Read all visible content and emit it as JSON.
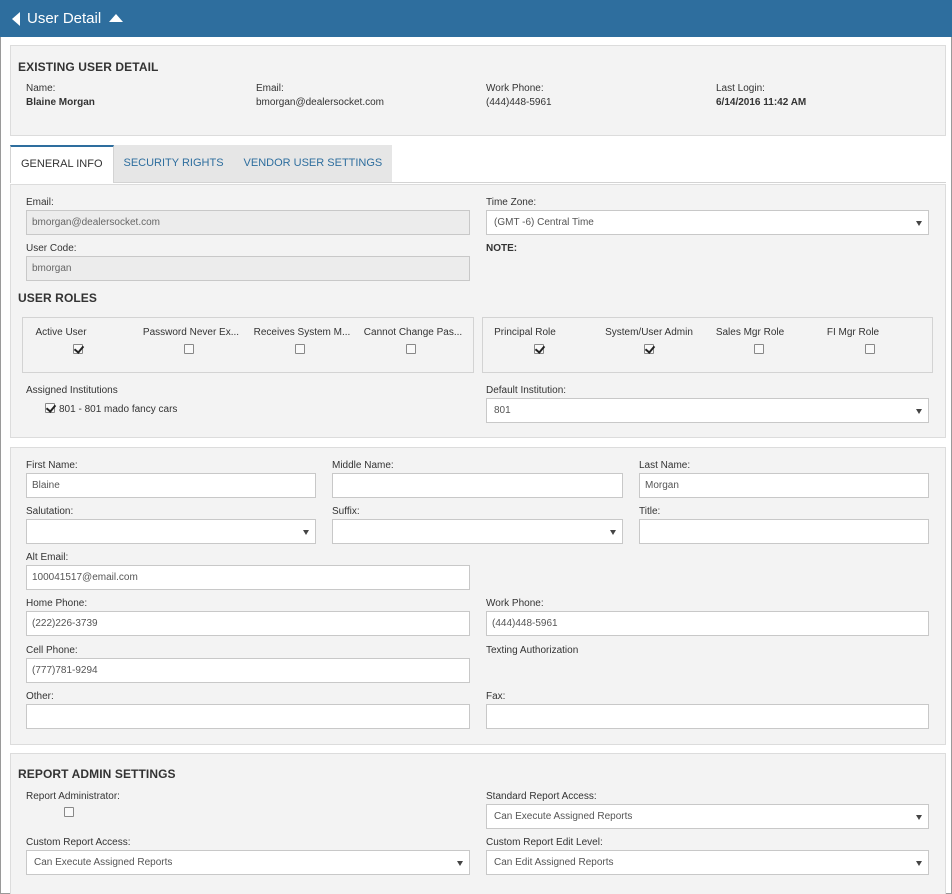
{
  "header": {
    "title": "User Detail"
  },
  "existing": {
    "title": "EXISTING USER DETAIL",
    "name_label": "Name:",
    "name": "Blaine Morgan",
    "email_label": "Email:",
    "email": "bmorgan@dealersocket.com",
    "phone_label": "Work Phone:",
    "phone": "(444)448-5961",
    "login_label": "Last Login:",
    "login": "6/14/2016 11:42 AM"
  },
  "tabs": [
    "GENERAL INFO",
    "SECURITY RIGHTS",
    "VENDOR USER SETTINGS"
  ],
  "general": {
    "email_label": "Email:",
    "email": "bmorgan@dealersocket.com",
    "timezone_label": "Time Zone:",
    "timezone": "(GMT -6) Central Time",
    "usercode_label": "User Code:",
    "usercode": "bmorgan",
    "note_label": "NOTE:"
  },
  "roles": {
    "title": "USER ROLES",
    "left": [
      {
        "label": "Active User",
        "checked": true
      },
      {
        "label": "Password Never Ex...",
        "checked": false
      },
      {
        "label": "Receives System M...",
        "checked": false
      },
      {
        "label": "Cannot Change Pas...",
        "checked": false
      }
    ],
    "right": [
      {
        "label": "Principal Role",
        "checked": true
      },
      {
        "label": "System/User Admin",
        "checked": true
      },
      {
        "label": "Sales Mgr Role",
        "checked": false
      },
      {
        "label": "FI Mgr Role",
        "checked": false
      }
    ],
    "assigned_label": "Assigned Institutions",
    "assigned_item": "801 - 801 mado fancy cars",
    "default_label": "Default Institution:",
    "default_value": "801"
  },
  "contact": {
    "first_label": "First Name:",
    "first": "Blaine",
    "middle_label": "Middle Name:",
    "middle": "",
    "last_label": "Last Name:",
    "last": "Morgan",
    "salutation_label": "Salutation:",
    "salutation": "",
    "suffix_label": "Suffix:",
    "suffix": "",
    "title_label": "Title:",
    "title": "",
    "altemail_label": "Alt Email:",
    "altemail": "100041517@email.com",
    "home_label": "Home Phone:",
    "home": "(222)226-3739",
    "work_label": "Work Phone:",
    "work": "(444)448-5961",
    "cell_label": "Cell Phone:",
    "cell": "(777)781-9294",
    "texting_label": "Texting Authorization",
    "other_label": "Other:",
    "other": "",
    "fax_label": "Fax:",
    "fax": ""
  },
  "report": {
    "title": "REPORT ADMIN SETTINGS",
    "admin_label": "Report Administrator:",
    "standard_label": "Standard Report Access:",
    "standard": "Can Execute Assigned Reports",
    "custom_label": "Custom Report Access:",
    "custom": "Can Execute Assigned Reports",
    "edit_label": "Custom Report Edit Level:",
    "edit": "Can Edit Assigned Reports"
  }
}
